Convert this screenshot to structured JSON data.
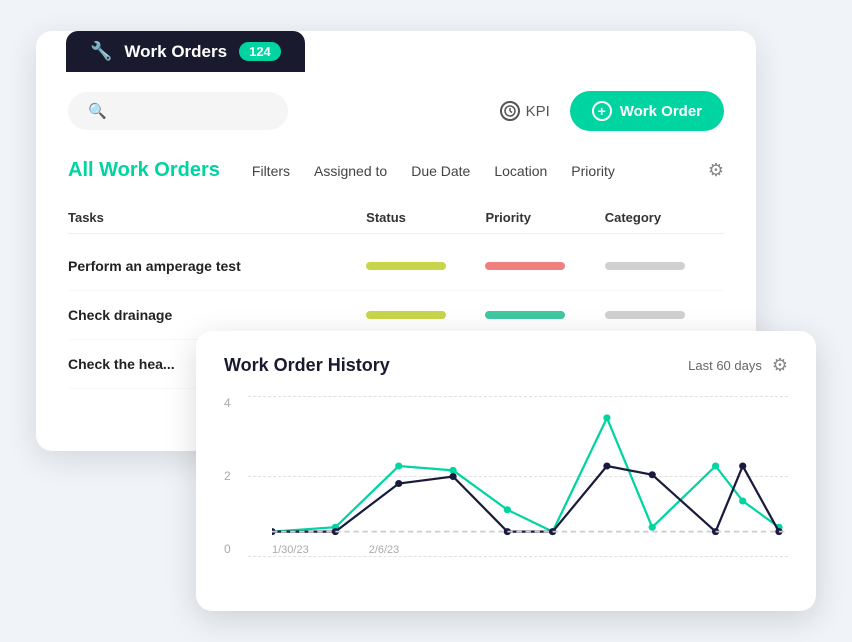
{
  "topbar": {
    "icon": "🔧",
    "title": "Work Orders",
    "badge": "124"
  },
  "search": {
    "placeholder": ""
  },
  "kpi": {
    "label": "KPI"
  },
  "workOrderButton": {
    "label": "Work Order"
  },
  "pageTitle": "All Work Orders",
  "filters": {
    "items": [
      "Filters",
      "Assigned to",
      "Due Date",
      "Location",
      "Priority"
    ]
  },
  "table": {
    "headers": [
      "Tasks",
      "Status",
      "Priority",
      "Category"
    ],
    "rows": [
      {
        "task": "Perform an amperage test",
        "statusColor": "yellow",
        "priorityColor": "red",
        "categoryColor": "gray"
      },
      {
        "task": "Check drainage",
        "statusColor": "yellow",
        "priorityColor": "green",
        "categoryColor": "gray"
      },
      {
        "task": "Check the hea...",
        "statusColor": "yellow",
        "priorityColor": "green",
        "categoryColor": "gray"
      }
    ]
  },
  "chart": {
    "title": "Work Order History",
    "period": "Last 60 days",
    "yLabels": [
      "4",
      "2",
      "0"
    ],
    "xLabels": [
      "1/30/23",
      "2/6/23"
    ],
    "series": {
      "teal": [
        {
          "x": 0,
          "y": 160
        },
        {
          "x": 80,
          "y": 158
        },
        {
          "x": 160,
          "y": 80
        },
        {
          "x": 240,
          "y": 80
        },
        {
          "x": 320,
          "y": 158
        },
        {
          "x": 400,
          "y": 158
        },
        {
          "x": 480,
          "y": 20
        },
        {
          "x": 520,
          "y": 158
        }
      ],
      "dark": [
        {
          "x": 0,
          "y": 158
        },
        {
          "x": 80,
          "y": 158
        },
        {
          "x": 160,
          "y": 100
        },
        {
          "x": 240,
          "y": 90
        },
        {
          "x": 320,
          "y": 155
        },
        {
          "x": 400,
          "y": 158
        },
        {
          "x": 480,
          "y": 90
        },
        {
          "x": 520,
          "y": 80
        },
        {
          "x": 560,
          "y": 158
        }
      ]
    }
  }
}
